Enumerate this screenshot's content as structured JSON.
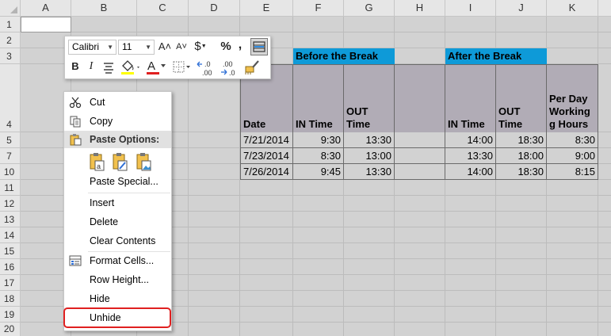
{
  "columns": [
    "A",
    "B",
    "C",
    "D",
    "E",
    "F",
    "G",
    "H",
    "I",
    "J",
    "K"
  ],
  "rows": [
    "1",
    "2",
    "3",
    "4",
    "5",
    "7",
    "10",
    "11",
    "12",
    "13",
    "14",
    "15",
    "16",
    "17",
    "18",
    "19",
    "20"
  ],
  "bands": {
    "before": "Before the Break",
    "after": "After the Break"
  },
  "headers": {
    "date": "Date",
    "in1": "IN Time",
    "out1": "OUT\nTime",
    "in2": "IN Time",
    "out2": "OUT\nTime",
    "hours": "Per Day\nWorking\ng Hours"
  },
  "data": [
    {
      "date": "7/21/2014",
      "in1": "9:30",
      "out1": "13:30",
      "in2": "14:00",
      "out2": "18:30",
      "hours": "8:30"
    },
    {
      "date": "7/23/2014",
      "in1": "8:30",
      "out1": "13:00",
      "in2": "13:30",
      "out2": "18:00",
      "hours": "9:00"
    },
    {
      "date": "7/26/2014",
      "in1": "9:45",
      "out1": "13:30",
      "in2": "14:00",
      "out2": "18:30",
      "hours": "8:15"
    }
  ],
  "mini_toolbar": {
    "font": "Calibri",
    "size": "11",
    "grow": "A˄",
    "shrink": "A˅",
    "currency": "$",
    "percent": "%",
    "comma": ",",
    "bold": "B",
    "italic": "I",
    "font_color_letter": "A",
    "inc_decimal": "←.0\n.00",
    "dec_decimal": ".00\n→.0"
  },
  "menu": {
    "cut": "Cut",
    "copy": "Copy",
    "paste_options": "Paste Options:",
    "paste_special": "Paste Special...",
    "insert": "Insert",
    "delete": "Delete",
    "clear_contents": "Clear Contents",
    "format_cells": "Format Cells...",
    "row_height": "Row Height...",
    "hide": "Hide",
    "unhide": "Unhide"
  },
  "colors": {
    "band": "#0e9ad8",
    "header_fill": "#b1acb6",
    "sheet": "#d2d2d2",
    "highlight": "#e02020",
    "font_color_bar": "#e02020"
  }
}
